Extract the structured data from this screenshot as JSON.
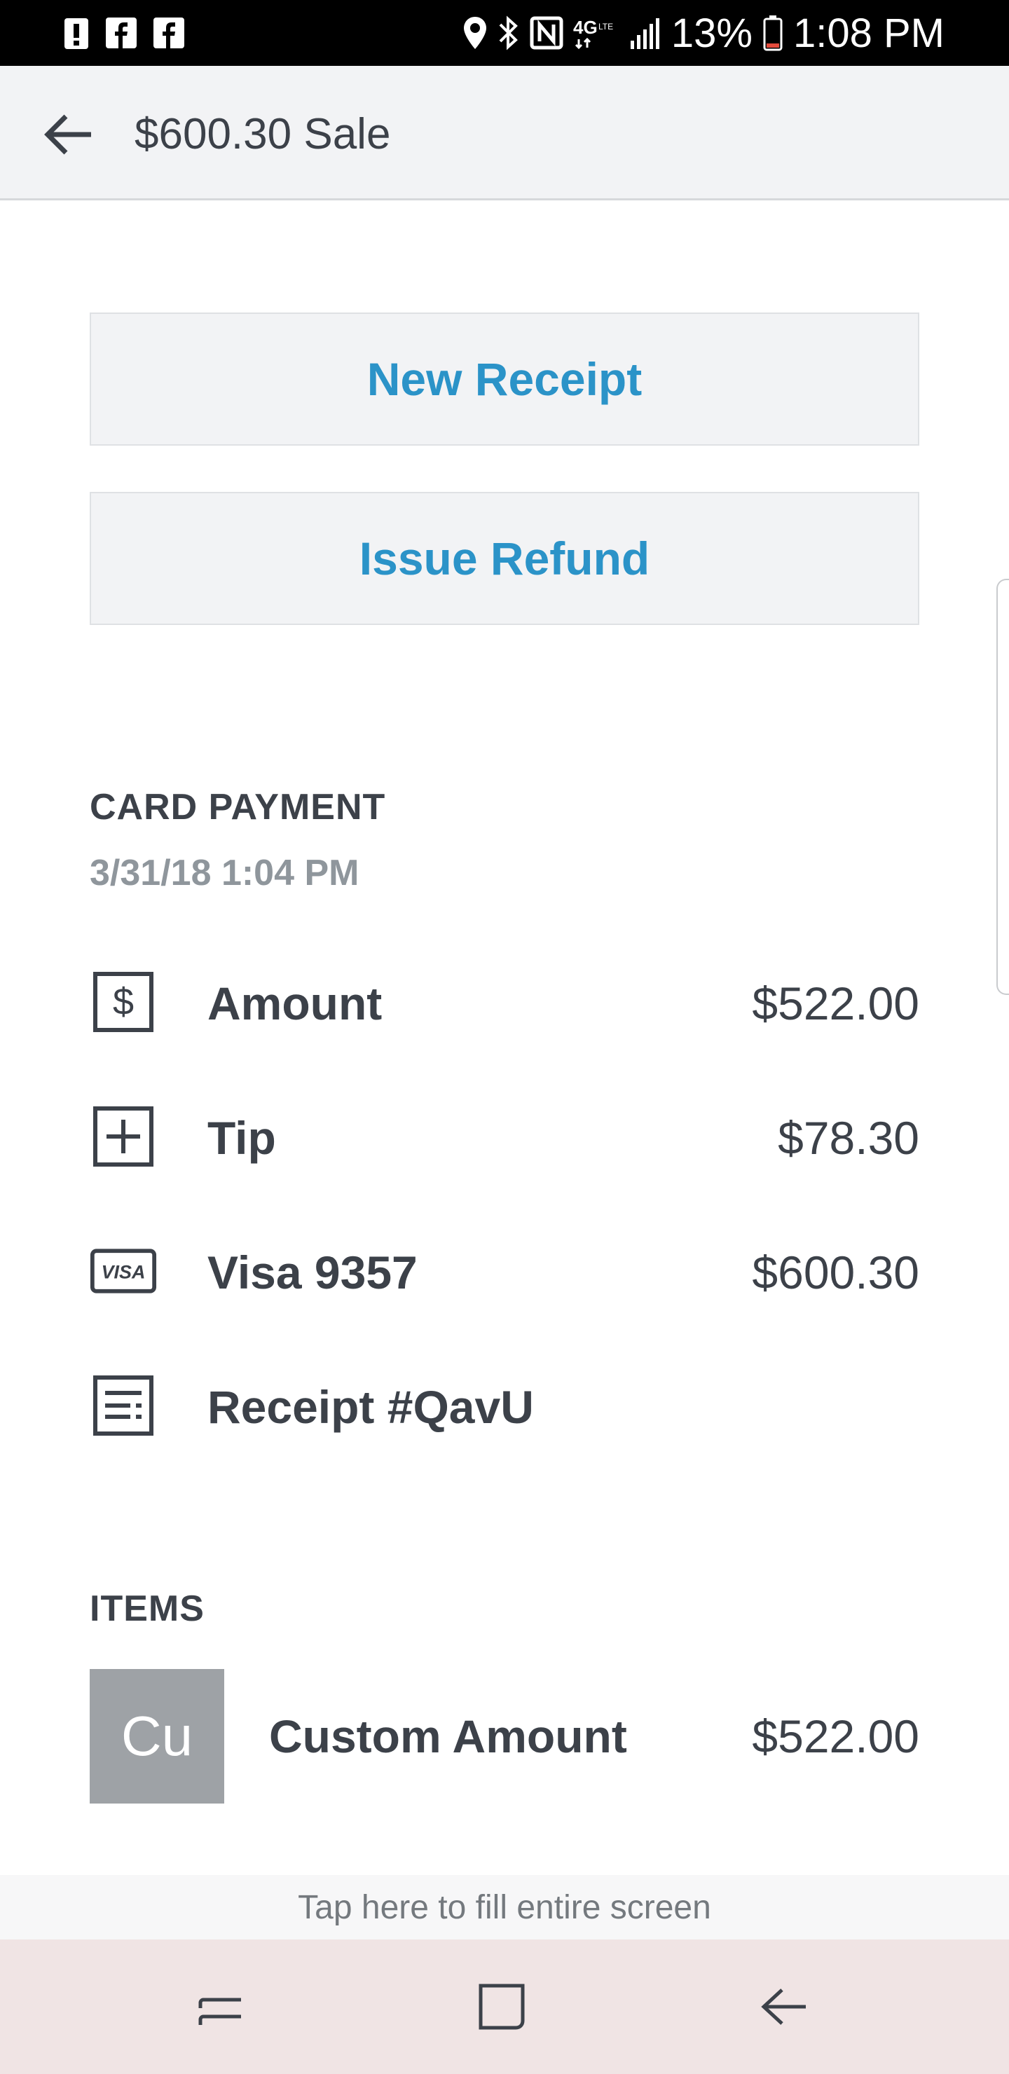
{
  "status_bar": {
    "battery": "13%",
    "time": "1:08 PM",
    "network": "4G LTE",
    "left_icons": [
      "alert-icon",
      "facebook-icon",
      "facebook-icon"
    ],
    "right_icons": [
      "location-icon",
      "bluetooth-icon",
      "nfc-icon",
      "network-icon",
      "signal-icon",
      "battery-icon"
    ]
  },
  "header": {
    "title": "$600.30 Sale",
    "back_icon": "back-arrow-icon"
  },
  "actions": {
    "new_receipt": "New Receipt",
    "issue_refund": "Issue Refund"
  },
  "payment": {
    "section_title": "CARD PAYMENT",
    "date": "3/31/18 1:04 PM",
    "rows": [
      {
        "icon": "dollar-icon",
        "label": "Amount",
        "value": "$522.00"
      },
      {
        "icon": "plus-box-icon",
        "label": "Tip",
        "value": "$78.30"
      },
      {
        "icon": "visa-card-icon",
        "label": "Visa 9357",
        "value": "$600.30"
      },
      {
        "icon": "receipt-icon",
        "label": "Receipt #QavU",
        "value": ""
      }
    ]
  },
  "items": {
    "section_title": "ITEMS",
    "list": [
      {
        "thumb": "Cu",
        "name": "Custom Amount",
        "price": "$522.00"
      }
    ]
  },
  "fill_prompt": "Tap here to fill entire screen",
  "nav_bar": {
    "icons": [
      "recent-apps-icon",
      "home-icon",
      "back-icon"
    ]
  },
  "colors": {
    "accent": "#2b93c8",
    "text": "#3c4149",
    "muted": "#8f969c",
    "thumb": "#9ea2a6"
  }
}
